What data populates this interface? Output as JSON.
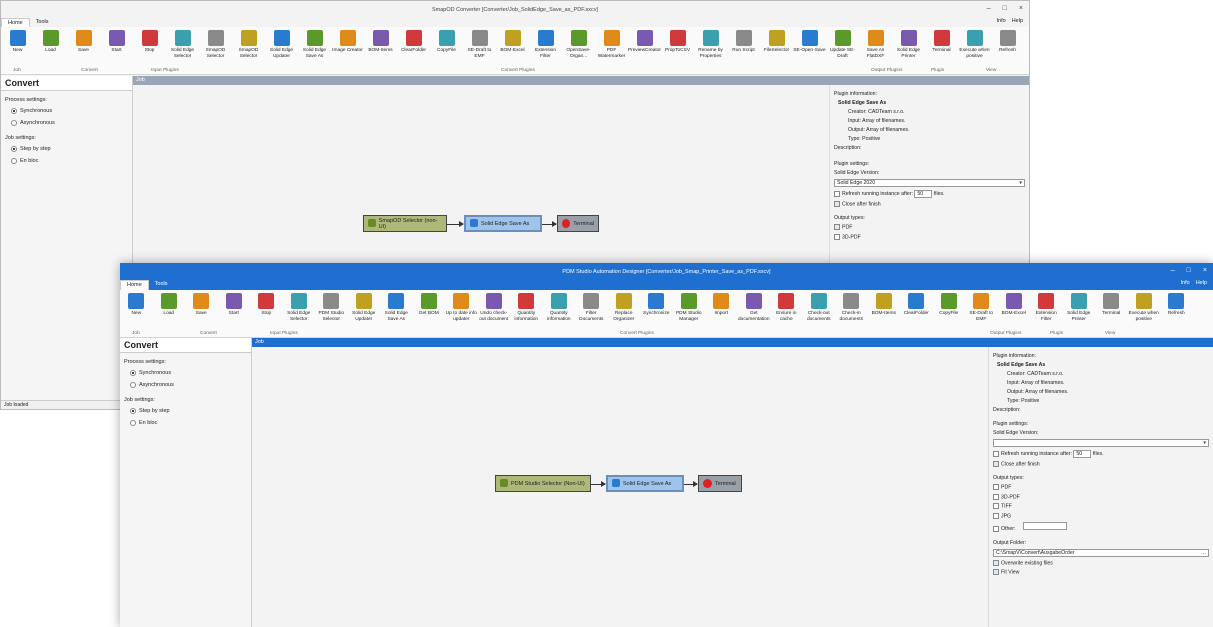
{
  "w1": {
    "title": "SmapOD Converter [Converter/Job_SolidEdge_Save_as_PDF.sxcv]",
    "tabs": [
      "Home",
      "Tools"
    ],
    "help": [
      "Info",
      "Help"
    ],
    "ribbon": [
      "New",
      "Load",
      "Save",
      "Start",
      "Stop",
      "Solid Edge Selector",
      "SmapOD Selector",
      "SmapOD Selector",
      "Solid Edge Updater",
      "Solid Edge Save As",
      "Image Creator",
      "BOM-Items",
      "ClearFolder",
      "CopyFile",
      "SE-Draft to EMF",
      "BOM-Excel",
      "Extension Filter",
      "OpenSave-Organ...",
      "PDF Watermarker",
      "PreviewCreator",
      "PropToCSV",
      "Rename by Properties",
      "Run Script",
      "FileSelector",
      "SE-Open-Save",
      "Update SE-Draft",
      "Save As FlatDXF",
      "Solid Edge Printer",
      "Terminal",
      "Execute when positive",
      "Refresh"
    ],
    "groups": [
      "Job",
      "Convert",
      "Input Plugins",
      "Convert Plugins",
      "Output Plugins",
      "Plugin",
      "View"
    ],
    "side_title": "Convert",
    "process_label": "Process settings:",
    "process_opts": [
      "Synchronous",
      "Asynchronous"
    ],
    "job_label": "Job settings:",
    "job_opts": [
      "Step by step",
      "En bloc"
    ],
    "status": "Job loaded",
    "job_header": "Job",
    "nodes": [
      "SmapOD Selector (non-UI)",
      "Solid Edge Save As",
      "Terminal"
    ],
    "panel": {
      "info_label": "Plugin information:",
      "name": "Solid Edge Save As",
      "creator": "Creator: CADTeam s.r.o.",
      "input": "Input: Array of filenames.",
      "output": "Output: Array of filenames.",
      "type": "Type: Positive",
      "desc": "Description:",
      "settings_label": "Plugin settings:",
      "version_label": "Solid Edge Version:",
      "version": "Solid Edge 2020",
      "refresh": "Refresh running instance after:",
      "refresh_n": "50",
      "refresh_unit": "files.",
      "close": "Close after finish",
      "output_types": "Output types:",
      "types": [
        "PDF",
        "3D-PDF"
      ]
    }
  },
  "w2": {
    "title": "PDM Studio Automation Designer [Converter/Job_Smap_Printer_Save_as_PDF.sxcv]",
    "tabs": [
      "Home",
      "Tools"
    ],
    "help": [
      "Info",
      "Help"
    ],
    "ribbon": [
      "New",
      "Load",
      "Save",
      "Start",
      "Stop",
      "Solid Edge Selector",
      "PDM Studio Selector",
      "Solid Edge Updater",
      "Solid Edge Save As",
      "Get BOM",
      "Up to date info updater",
      "Undo check-out document",
      "Quantity information",
      "Quantity information",
      "Filter Documents",
      "Replace Organizer",
      "Synchronize",
      "PDM Studio Manager",
      "Import",
      "Get documentation",
      "Ensure in cache",
      "Check-out documents",
      "Check-in documents",
      "BOM-Items",
      "ClearFolder",
      "CopyFile",
      "SE-Draft to EMF",
      "BOM-Excel",
      "Extension Filter",
      "Solid Edge Printer",
      "Terminal",
      "Execute when positive",
      "Refresh"
    ],
    "groups": [
      "Job",
      "Convert",
      "Input Plugins",
      "Convert Plugins",
      "Output Plugins",
      "Plugin",
      "View"
    ],
    "side_title": "Convert",
    "process_label": "Process settings:",
    "process_opts": [
      "Synchronous",
      "Asynchronous"
    ],
    "job_label": "Job settings:",
    "job_opts": [
      "Step by step",
      "En bloc"
    ],
    "job_header": "Job",
    "nodes": [
      "PDM Studio Selector (Non-UI)",
      "Solid Edge Save As",
      "Terminal"
    ],
    "panel": {
      "info_label": "Plugin information:",
      "name": "Solid Edge Save As",
      "creator": "Creator: CADTeam s.r.o.",
      "input": "Input: Array of filenames.",
      "output": "Output: Array of filenames.",
      "type": "Type: Positive",
      "desc": "Description:",
      "settings_label": "Plugin settings:",
      "version_label": "Solid Edge Version:",
      "refresh": "Refresh running instance after:",
      "refresh_n": "50",
      "refresh_unit": "files.",
      "close": "Close after finish",
      "output_types": "Output types:",
      "types": [
        "PDF",
        "3D-PDF",
        "TIFF",
        "JPG",
        "Other:"
      ],
      "folder_label": "Output Folder:",
      "folder": "C:\\SmapV\\Convert\\AusgabeOrder",
      "overwrite": "Overwrite existing files",
      "fit": "Fit View"
    }
  },
  "colors": {
    "accent": "#1f6fd0",
    "node": "#aeb879",
    "selected": "#9fc3ea",
    "terminal": "#e02020"
  }
}
